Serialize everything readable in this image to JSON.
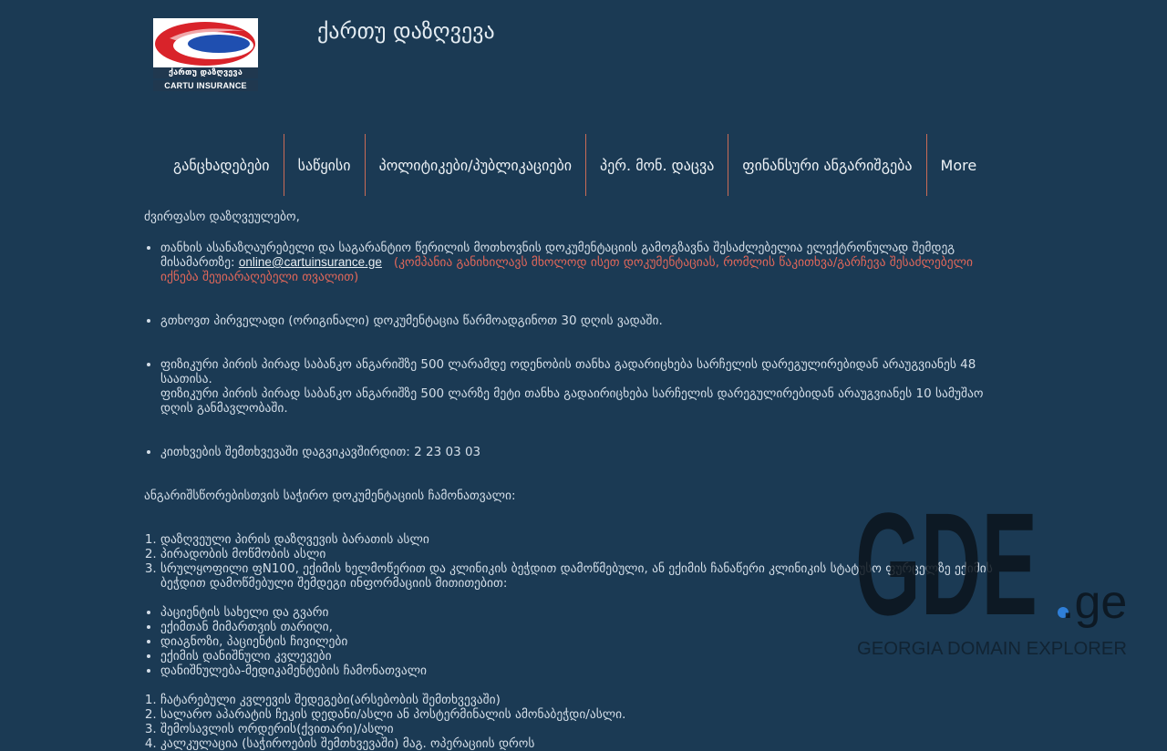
{
  "header": {
    "logo_text_ka": "ქართუ დაზღვევა",
    "logo_text_en": "CARTU INSURANCE",
    "title": "ქართუ დაზღვევა",
    "brand_red": "#d9232a",
    "brand_blue": "#1f4fb0"
  },
  "nav": {
    "items": [
      "განცხადებები",
      "საწყისი",
      "პოლიტიკები/პუბლიკაციები",
      "პერ. მონ. დაცვა",
      "ფინანსური ანგარიშგება",
      "More"
    ]
  },
  "content": {
    "greeting": "ძვირფასო დაზღვეულებო,",
    "bullets": {
      "b1_text": "თანხის ასანაზღაურებელი და საგარანტიო წერილის მოთხოვნის დოკუმენტაციის გამოგზავნა შესაძლებელია ელექტრონულად შემდეგ მისამართზე: ",
      "b1_email": "online@cartuinsurance.ge",
      "b1_note": "(კომპანია განიხილავს მხოლოდ ისეთ დოკუმენტაციას, რომლის წაკითხვა/გარჩევა შესაძლებელი იქნება შეუიარაღებელი თვალით)",
      "b2": "გთხოვთ პირველადი (ორიგინალი) დოკუმენტაცია წარმოადგინოთ 30 დღის ვადაში.",
      "b3_line1": "ფიზიკური პირის პირად საბანკო ანგარიშზე 500 ლარამდე ოდენობის თანხა   გადარიცხება სარჩელის დარეგულირებიდან არაუგვიანეს 48 საათისა.",
      "b3_line2": "ფიზიკური პირის პირად საბანკო ანგარიშზე 500 ლარზე მეტი თანხა გადაირიცხება სარჩელის დარეგულირებიდან არაუგვიანეს 10 სამუშაო დღის განმავლობაში.",
      "b4": " კითხვების შემთხვევაში  დაგვიკავშირდით: 2 23 03 03"
    },
    "docs_heading": "ანგარიშსწორებისთვის საჭირო დოკუმენტაციის ჩამონათვალი:",
    "docs_list": [
      "დაზღვეული პირის დაზღვევის ბარათის ასლი",
      "პირადობის მოწმობის ასლი",
      "სრულყოფილი ფN100, ექიმის ხელმოწერით და კლინიკის ბეჭდით დამოწმებული, ან ექიმის ჩანაწერი კლინიკის სტატუსო ფურცელზე ექიმის ბეჭდით დამოწმებული შემდეგი ინფორმაციის მითითებით:"
    ],
    "info_list": [
      "პაციენტის სახელი და გვარი",
      "ექიმთან მიმართვის თარიღი,",
      " დიაგნოზი, პაციენტის ჩივილები",
      "ექიმის დანიშნული კვლევები",
      "დანიშნულება-მედიკამენტების ჩამონათვალი"
    ],
    "extra_list": [
      "ჩატარებული კვლევის შედეგები(არსებობის შემთხვევაში)",
      "სალარო აპარატის ჩეკის დედანი/ასლი ან პოსტერმინალის ამონაბეჭდი/ასლი.",
      "შემოსავლის ორდერის(ქვითარი)/ასლი",
      "კალკულაცია (საჭიროების შემთხვევაში) მაგ. ოპერაციის დროს"
    ]
  },
  "watermark": {
    "logo_text": "GDE",
    "suffix": ".ge",
    "tagline": "GEORGIA DOMAIN EXPLORER"
  }
}
